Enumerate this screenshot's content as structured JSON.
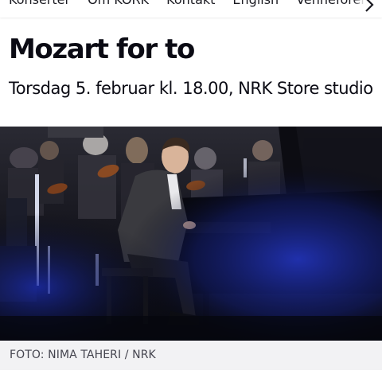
{
  "nav": {
    "items": [
      "Konserter",
      "Om KORK",
      "Kontakt",
      "English",
      "Venneforening"
    ]
  },
  "header": {
    "title": "Mozart for to",
    "subtitle": "Torsdag 5. februar kl. 18.00, NRK Store studio"
  },
  "photo": {
    "caption": "FOTO: NIMA TAHERI / NRK"
  },
  "colors": {
    "text": "#0b0b14",
    "caption_bg": "#f2f2f4",
    "stage_blue": "#1c2a9a"
  },
  "icons": {
    "nav_scroll": "chevron-right-icon"
  }
}
